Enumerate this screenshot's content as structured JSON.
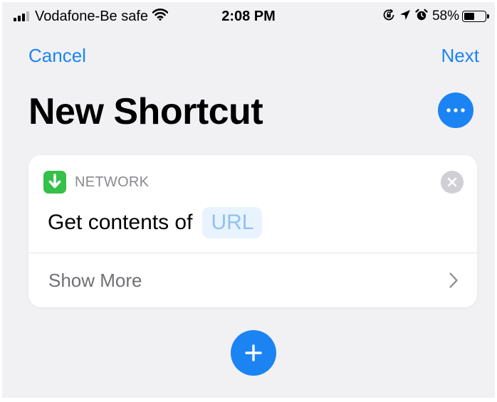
{
  "status_bar": {
    "carrier": "Vodafone-Be safe",
    "time": "2:08 PM",
    "battery_percent": "58%",
    "battery_level": 0.58,
    "signal_bars_filled": 3,
    "signal_bars_total": 4,
    "icons": [
      "signal-icon",
      "wifi-icon",
      "orientation-lock-icon",
      "location-arrow-icon",
      "alarm-icon",
      "battery-icon"
    ]
  },
  "nav": {
    "cancel_label": "Cancel",
    "next_label": "Next"
  },
  "page": {
    "title": "New Shortcut",
    "more_icon": "ellipsis-icon"
  },
  "action_card": {
    "category": "NETWORK",
    "category_icon": "download-arrow-icon",
    "category_color": "#34c04a",
    "action_text": "Get contents of",
    "url_token": "URL",
    "show_more_label": "Show More",
    "remove_icon": "close-icon",
    "chevron_icon": "chevron-right-icon"
  },
  "add_button": {
    "icon": "plus-icon"
  },
  "colors": {
    "accent": "#1b84f2",
    "background": "#f1f1f4",
    "card": "#ffffff",
    "token_bg": "#e9f3fd",
    "token_text": "#8fc1f3"
  }
}
